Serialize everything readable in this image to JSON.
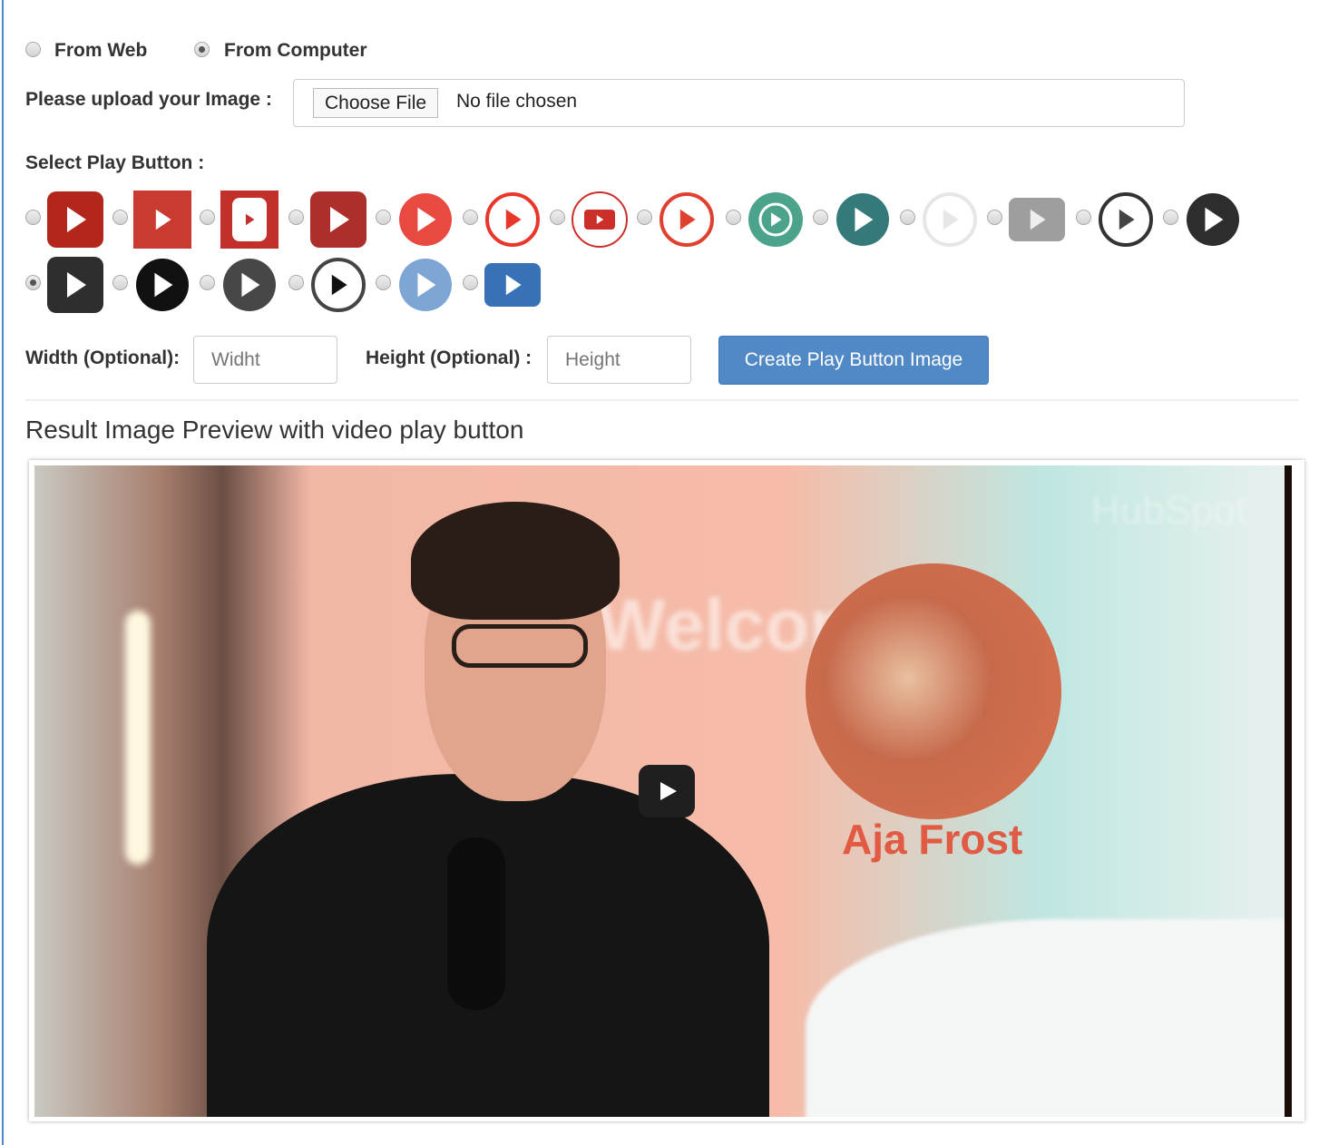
{
  "source": {
    "options": [
      {
        "label": "From Web",
        "selected": false
      },
      {
        "label": "From Computer",
        "selected": true
      }
    ]
  },
  "upload": {
    "label": "Please upload your Image :",
    "button": "Choose File",
    "status": "No file chosen"
  },
  "play_select": {
    "label": "Select Play Button :",
    "selected_index": 14,
    "icons": [
      {
        "name": "youtube-rounded-red",
        "shape": "rsq",
        "bg": "#b3261b",
        "tri": "#fff"
      },
      {
        "name": "square-red-gradient",
        "shape": "sq",
        "bg": "#c93a30",
        "tri": "#fff"
      },
      {
        "name": "square-red-white-box",
        "shape": "box",
        "bg": "#c1302b",
        "tri": "#c1302b"
      },
      {
        "name": "rounded-darkred-big",
        "shape": "rsq",
        "bg": "#ad2f2c",
        "tri": "#fff"
      },
      {
        "name": "circle-red",
        "shape": "circle",
        "bg": "#e84a42",
        "tri": "#fff"
      },
      {
        "name": "ring-red",
        "shape": "ring",
        "bg": "#e8372a",
        "tri": "#e8372a"
      },
      {
        "name": "ring-red-youtube",
        "shape": "ringyt",
        "bg": "#cc2f2a",
        "tri": "#fff"
      },
      {
        "name": "ring-red-thin",
        "shape": "ring",
        "bg": "#e0402f",
        "tri": "#e0402f"
      },
      {
        "name": "circle-green-ring",
        "shape": "circlering",
        "bg": "#4ba38c",
        "tri": "#fff"
      },
      {
        "name": "circle-teal",
        "shape": "circle",
        "bg": "#357a7b",
        "tri": "#fff"
      },
      {
        "name": "ring-white",
        "shape": "ring",
        "bg": "#e6e6e6",
        "tri": "#e6e6e6"
      },
      {
        "name": "rounded-gray",
        "shape": "rsqs",
        "bg": "#9e9e9e",
        "tri": "#eee"
      },
      {
        "name": "ring-black",
        "shape": "ring",
        "bg": "#333",
        "tri": "#444"
      },
      {
        "name": "circle-black-glossy",
        "shape": "circle",
        "bg": "#2d2d2d",
        "tri": "#fff"
      },
      {
        "name": "rounded-black",
        "shape": "rsq",
        "bg": "#2e2e2e",
        "tri": "#fff"
      },
      {
        "name": "circle-black-white-ring",
        "shape": "circle",
        "bg": "#111",
        "tri": "#fff"
      },
      {
        "name": "circle-darkgray",
        "shape": "circle",
        "bg": "#474747",
        "tri": "#fff"
      },
      {
        "name": "ring-darkgray",
        "shape": "ring",
        "bg": "#444",
        "tri": "#111"
      },
      {
        "name": "circle-lightblue",
        "shape": "circle",
        "bg": "#7ea6d4",
        "tri": "#fff"
      },
      {
        "name": "rounded-blue",
        "shape": "rsqs",
        "bg": "#3872b6",
        "tri": "#fff"
      }
    ]
  },
  "dimensions": {
    "width_label": "Width (Optional):",
    "width_placeholder": "Widht",
    "height_label": "Height (Optional) :",
    "height_placeholder": "Height"
  },
  "create_button": "Create Play Button Image",
  "preview": {
    "title": "Result Image Preview with video play button",
    "overlay_name": "Aja Frost",
    "wall_text": "Welcome",
    "watermark": "HubSpot"
  }
}
